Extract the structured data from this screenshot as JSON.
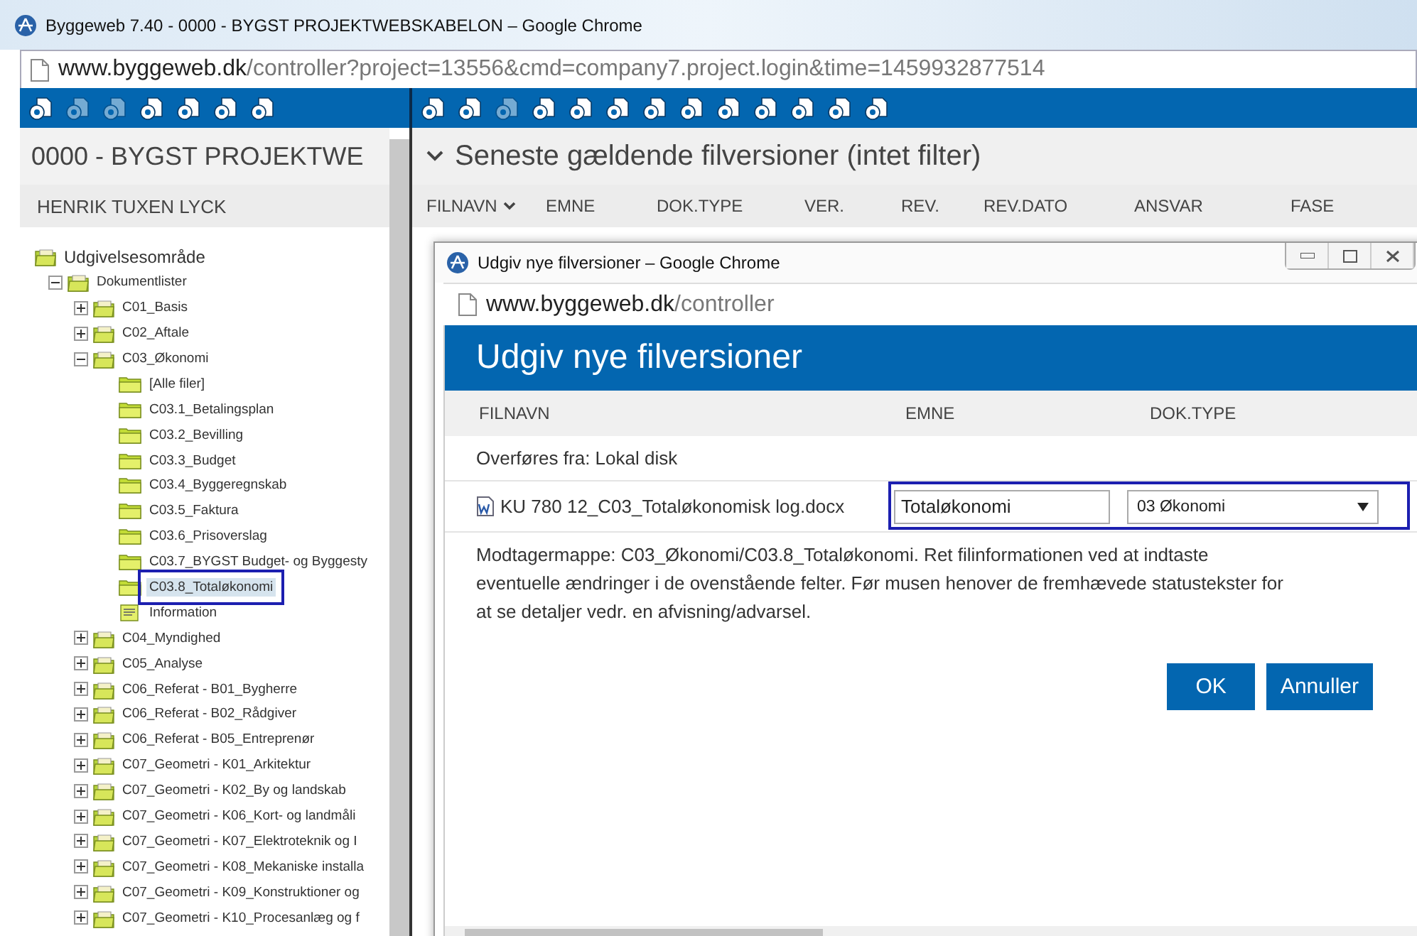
{
  "browser": {
    "title": "Byggeweb 7.40 - 0000 - BYGST PROJEKTWEBSKABELON – Google Chrome",
    "url_host": "www.byggeweb.dk",
    "url_path": "/controller?project=13556&cmd=company7.project.login&time=1459932877514"
  },
  "left_toolbar": [
    {
      "disabled": false
    },
    {
      "disabled": true
    },
    {
      "disabled": true
    },
    {
      "disabled": false
    },
    {
      "disabled": false
    },
    {
      "disabled": false
    },
    {
      "disabled": false
    }
  ],
  "right_toolbar": [
    {
      "disabled": false
    },
    {
      "disabled": false
    },
    {
      "disabled": true
    },
    {
      "disabled": false
    },
    {
      "disabled": false
    },
    {
      "disabled": false
    },
    {
      "disabled": false
    },
    {
      "disabled": false
    },
    {
      "disabled": false
    },
    {
      "disabled": false
    },
    {
      "disabled": false
    },
    {
      "disabled": false
    },
    {
      "disabled": false
    }
  ],
  "project": {
    "title": "0000 - BYGST PROJEKTWE",
    "user": "HENRIK TUXEN LYCK"
  },
  "tree": {
    "label": "Udgivelsesområde",
    "kind": "area",
    "children": [
      {
        "label": "Dokumentlister",
        "kind": "list",
        "expanded": true,
        "children": [
          {
            "label": "C01_Basis",
            "kind": "list",
            "expanded": false
          },
          {
            "label": "C02_Aftale",
            "kind": "list",
            "expanded": false
          },
          {
            "label": "C03_Økonomi",
            "kind": "list",
            "expanded": true,
            "children": [
              {
                "label": "[Alle filer]",
                "kind": "folder",
                "selected": false,
                "annotated": false
              },
              {
                "label": "C03.1_Betalingsplan",
                "kind": "folder",
                "selected": false,
                "annotated": false
              },
              {
                "label": "C03.2_Bevilling",
                "kind": "folder",
                "selected": false,
                "annotated": false
              },
              {
                "label": "C03.3_Budget",
                "kind": "folder",
                "selected": false,
                "annotated": false
              },
              {
                "label": "C03.4_Byggeregnskab",
                "kind": "folder",
                "selected": false,
                "annotated": false
              },
              {
                "label": "C03.5_Faktura",
                "kind": "folder",
                "selected": false,
                "annotated": false
              },
              {
                "label": "C03.6_Prisoverslag",
                "kind": "folder",
                "selected": false,
                "annotated": false
              },
              {
                "label": "C03.7_BYGST Budget- og Byggesty",
                "kind": "folder",
                "selected": false,
                "annotated": false
              },
              {
                "label": "C03.8_Totaløkonomi",
                "kind": "folder",
                "selected": true,
                "annotated": true
              },
              {
                "label": "Information",
                "kind": "info",
                "selected": false,
                "annotated": false
              }
            ]
          },
          {
            "label": "C04_Myndighed",
            "kind": "list",
            "expanded": false
          },
          {
            "label": "C05_Analyse",
            "kind": "list",
            "expanded": false
          },
          {
            "label": "C06_Referat - B01_Bygherre",
            "kind": "list",
            "expanded": false
          },
          {
            "label": "C06_Referat - B02_Rådgiver",
            "kind": "list",
            "expanded": false
          },
          {
            "label": "C06_Referat - B05_Entreprenør",
            "kind": "list",
            "expanded": false
          },
          {
            "label": "C07_Geometri - K01_Arkitektur",
            "kind": "list",
            "expanded": false
          },
          {
            "label": "C07_Geometri - K02_By og landskab",
            "kind": "list",
            "expanded": false
          },
          {
            "label": "C07_Geometri - K06_Kort- og landmåli",
            "kind": "list",
            "expanded": false
          },
          {
            "label": "C07_Geometri - K07_Elektroteknik og I",
            "kind": "list",
            "expanded": false
          },
          {
            "label": "C07_Geometri - K08_Mekaniske installa",
            "kind": "list",
            "expanded": false
          },
          {
            "label": "C07_Geometri - K09_Konstruktioner og",
            "kind": "list",
            "expanded": false
          },
          {
            "label": "C07_Geometri - K10_Procesanlæg og f",
            "kind": "list",
            "expanded": false
          }
        ]
      }
    ]
  },
  "list": {
    "title": "Seneste gældende filversioner (intet filter)",
    "columns": [
      {
        "label": "FILNAVN",
        "sorted": true
      },
      {
        "label": "EMNE",
        "sorted": false
      },
      {
        "label": "DOK.TYPE",
        "sorted": false
      },
      {
        "label": "VER.",
        "sorted": false
      },
      {
        "label": "REV.",
        "sorted": false
      },
      {
        "label": "REV.DATO",
        "sorted": false
      },
      {
        "label": "ANSVAR",
        "sorted": false
      },
      {
        "label": "FASE",
        "sorted": false
      }
    ]
  },
  "dialog": {
    "title": "Udgiv nye filversioner – Google Chrome",
    "url_host": "www.byggeweb.dk",
    "url_path": "/controller",
    "heading": "Udgiv nye filversioner",
    "columns": [
      "FILNAVN",
      "EMNE",
      "DOK.TYPE"
    ],
    "source": "Overføres fra: Lokal disk",
    "file": {
      "name": "KU 780 12_C03_Totaløkonomisk log.docx",
      "subject": "Totaløkonomi",
      "doc_type": "03 Økonomi",
      "annotated": true
    },
    "message": "Modtagermappe: C03_Økonomi/C03.8_Totaløkonomi. Ret filinformationen ved at indtaste eventuelle ændringer i de ovenstående felter. Før musen henover de fremhævede statustekster for at se detaljer vedr. en afvisning/advarsel.",
    "buttons": [
      "OK",
      "Annuller"
    ]
  }
}
